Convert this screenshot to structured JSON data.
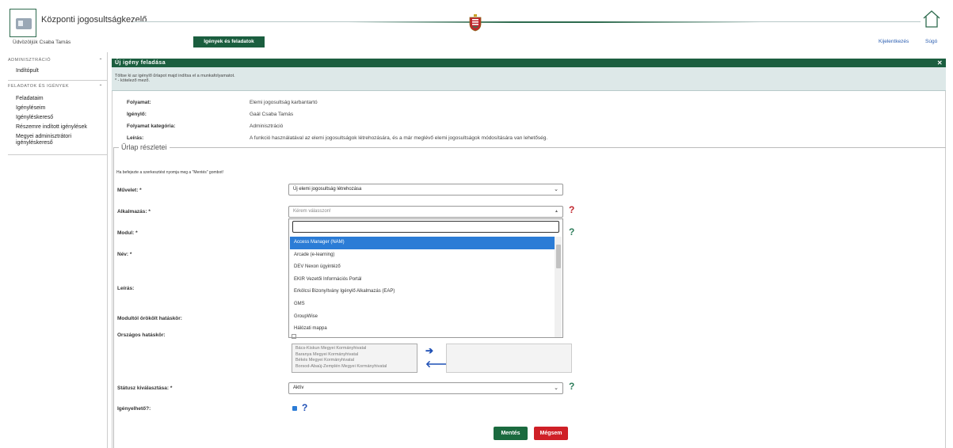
{
  "header": {
    "app_title": "Központi jogosultságkezelő",
    "welcome": "Üdvözöljük Csaba Tamás",
    "main_tab": "Igények és feladatok",
    "logout": "Kijelentkezés",
    "help": "Súgó"
  },
  "sidebar": {
    "section_admin": "ADMINISZTRÁCIÓ",
    "admin_items": [
      "Indítópult"
    ],
    "section_requests": "FELADATOK ÉS IGÉNYEK",
    "request_items": [
      "Feladataim",
      "Igényléseim",
      "Igényléskereső",
      "Részemre indított igénylések",
      "Megyei adminisztrátori igényléskereső"
    ]
  },
  "panel": {
    "title": "Új igény feladása",
    "info_line1": "Töltse ki az igénylő űrlapot majd indítsa el a munkafolyamatot.",
    "info_line2": "* - kötelező mező."
  },
  "meta": [
    {
      "label": "Folyamat:",
      "value": "Elemi jogosultság karbantartó"
    },
    {
      "label": "Igénylő:",
      "value": "Gaál Csaba Tamás"
    },
    {
      "label": "Folyamat kategória:",
      "value": "Adminisztráció"
    },
    {
      "label": "Leírás:",
      "value": "A funkció használatával az elemi jogosultságok létrehozására, és a már meglévő elemi jogosultságok módosítására van lehetőség."
    }
  ],
  "form": {
    "legend": "Űrlap részletei",
    "hint": "Ha befejezte a szerkesztést nyomja meg a \"Mentés\" gombot!",
    "labels": {
      "operation": "Művelet: *",
      "application": "Alkalmazás: *",
      "module": "Modul: *",
      "name": "Név: *",
      "description": "Leírás:",
      "inherited_scope": "Modultól örökölt hatáskör:",
      "national_scope": "Országos hatáskör:",
      "status": "Státusz kiválasztása: *",
      "requestable": "Igényelhető?:"
    },
    "operation_value": "Új elemi jogosultság létrehozása",
    "application_placeholder": "Kérem válasszon!",
    "status_value": "Aktív",
    "save_label": "Mentés",
    "cancel_label": "Mégsem"
  },
  "dropdown": {
    "search_value": "",
    "options": [
      "Access Manager (NAM)",
      "Arcade (e-learning)",
      "DEV Nexon ügyintéző",
      "EKIR Vezetői Információs Portál",
      "Erkölcsi Bizonyítvány Igénylő Alkalmazás (EAP)",
      "GMS",
      "GroupWise",
      "Hálózati mappa"
    ],
    "selected_index": 0
  },
  "counties": [
    "Bács-Kiskun Megyei Kormányhivatal",
    "Baranya Megyei Kormányhivatal",
    "Békés Megyei Kormányhivatal",
    "Borsod-Abaúj-Zemplén Megyei Kormányhivatal"
  ],
  "colors": {
    "primary_green": "#1b5e3f",
    "info_bg": "#dde8e8",
    "select_highlight": "#2b7cd6",
    "cancel_red": "#cf2027",
    "help_red": "#c0262d",
    "help_green": "#2e7d5b"
  },
  "icons": {
    "logo": "id-card-icon",
    "home": "home-icon",
    "crest": "hungarian-crest-icon",
    "help": "question-mark-icon",
    "chevron": "chevron-down-icon",
    "collapse": "double-chevron-up-icon",
    "move_right": "arrow-right-icon",
    "move_left": "arrow-left-icon",
    "close": "close-icon"
  }
}
